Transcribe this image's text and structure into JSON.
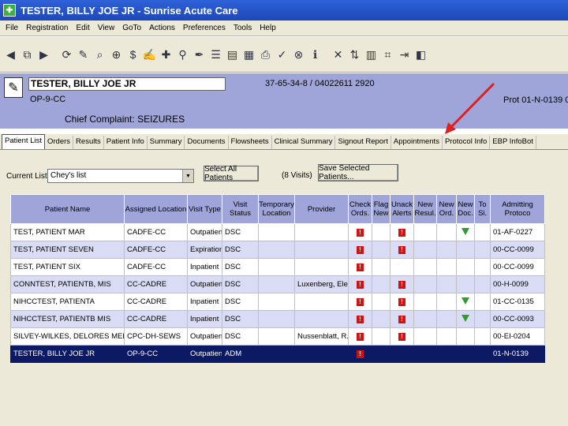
{
  "window": {
    "title": "TESTER, BILLY JOE JR - Sunrise Acute Care"
  },
  "menu": [
    "File",
    "Registration",
    "Edit",
    "View",
    "GoTo",
    "Actions",
    "Preferences",
    "Tools",
    "Help"
  ],
  "toolbar_icons": [
    "back-arrow-icon",
    "forward-pages-icon",
    "forward-arrow-icon",
    "refresh-icon",
    "order-icon",
    "search-icon",
    "zoom-icon",
    "dollar-icon",
    "note-icon",
    "pin-icon",
    "walk-icon",
    "pen-icon",
    "list-icon",
    "chart-icon",
    "document-icon",
    "print-icon",
    "signature-icon",
    "lock-icon",
    "info-icon",
    "cancel-icon",
    "sort-icon",
    "flowsheet-icon",
    "grid-icon",
    "exit-icon",
    "package-icon"
  ],
  "patient": {
    "name": "TESTER, BILLY JOE JR",
    "mrn": "37-65-34-8 / 04022611 2920",
    "location": "OP-9-CC",
    "protocol": "Prot 01-N-0139   0",
    "chief_complaint_label": "Chief Complaint:",
    "chief_complaint": "SEIZURES"
  },
  "tabs": [
    "Patient List",
    "Orders",
    "Results",
    "Patient Info",
    "Summary",
    "Documents",
    "Flowsheets",
    "Clinical Summary",
    "Signout Report",
    "Appointments",
    "Protocol Info",
    "EBP InfoBot"
  ],
  "active_tab": "Patient List",
  "list": {
    "label": "Current List:",
    "selected": "Chey's list",
    "select_all_label": "Select All Patients",
    "visits": "(8 Visits)",
    "save_label": "Save Selected Patients..."
  },
  "grid": {
    "columns": [
      "Patient Name",
      "Assigned Location",
      "Visit Type",
      "Visit Status",
      "Temporary Location",
      "Provider",
      "Check Ords.",
      "Flag New",
      "Unack Alerts",
      "New Resul.",
      "New Ord.",
      "New Doc.",
      "To Si.",
      "Admitting Protoco"
    ],
    "rows": [
      {
        "name": "TEST, PATIENT MAR",
        "loc": "CADFE-CC",
        "type": "Outpatient",
        "status": "DSC",
        "temp": "",
        "provider": "",
        "check": true,
        "flag": false,
        "unack": true,
        "newres": false,
        "neword": false,
        "newdoc": true,
        "tosi": false,
        "proto": "01-AF-0227"
      },
      {
        "name": "TEST, PATIENT SEVEN",
        "loc": "CADFE-CC",
        "type": "Expiration",
        "status": "DSC",
        "temp": "",
        "provider": "",
        "check": true,
        "flag": false,
        "unack": true,
        "newres": false,
        "neword": false,
        "newdoc": false,
        "tosi": false,
        "proto": "00-CC-0099"
      },
      {
        "name": "TEST, PATIENT SIX",
        "loc": "CADFE-CC",
        "type": "Inpatient",
        "status": "DSC",
        "temp": "",
        "provider": "",
        "check": true,
        "flag": false,
        "unack": false,
        "newres": false,
        "neword": false,
        "newdoc": false,
        "tosi": false,
        "proto": "00-CC-0099"
      },
      {
        "name": "CONNTEST, PATIENTB, MIS",
        "loc": "CC-CADRE",
        "type": "Outpatient",
        "status": "DSC",
        "temp": "",
        "provider": "Luxenberg, Ele...",
        "check": true,
        "flag": false,
        "unack": true,
        "newres": false,
        "neword": false,
        "newdoc": false,
        "tosi": false,
        "proto": "00-H-0099"
      },
      {
        "name": "NIHCCTEST, PATIENTA",
        "loc": "CC-CADRE",
        "type": "Inpatient",
        "status": "DSC",
        "temp": "",
        "provider": "",
        "check": true,
        "flag": false,
        "unack": true,
        "newres": false,
        "neword": false,
        "newdoc": true,
        "tosi": false,
        "proto": "01-CC-0135"
      },
      {
        "name": "NIHCCTEST, PATIENTB MIS",
        "loc": "CC-CADRE",
        "type": "Inpatient",
        "status": "DSC",
        "temp": "",
        "provider": "",
        "check": true,
        "flag": false,
        "unack": true,
        "newres": false,
        "neword": false,
        "newdoc": true,
        "tosi": false,
        "proto": "00-CC-0093"
      },
      {
        "name": "SILVEY-WILKES, DELORES MER...",
        "loc": "CPC-DH-SEWS",
        "type": "Outpatient",
        "status": "DSC",
        "temp": "",
        "provider": "Nussenblatt, R...",
        "check": true,
        "flag": false,
        "unack": true,
        "newres": false,
        "neword": false,
        "newdoc": false,
        "tosi": false,
        "proto": "00-EI-0204"
      },
      {
        "name": "TESTER, BILLY JOE JR",
        "loc": "OP-9-CC",
        "type": "Outpatient",
        "status": "ADM",
        "temp": "",
        "provider": "",
        "check": true,
        "flag": false,
        "unack": false,
        "newres": false,
        "neword": false,
        "newdoc": false,
        "tosi": false,
        "proto": "01-N-0139"
      }
    ],
    "selected_row": 7
  },
  "colors": {
    "header_band": "#9fa5d8",
    "selected_row": "#0c1a66",
    "alert": "#d41111",
    "new_doc": "#2e9d2e",
    "annotation_arrow": "#e02020"
  }
}
